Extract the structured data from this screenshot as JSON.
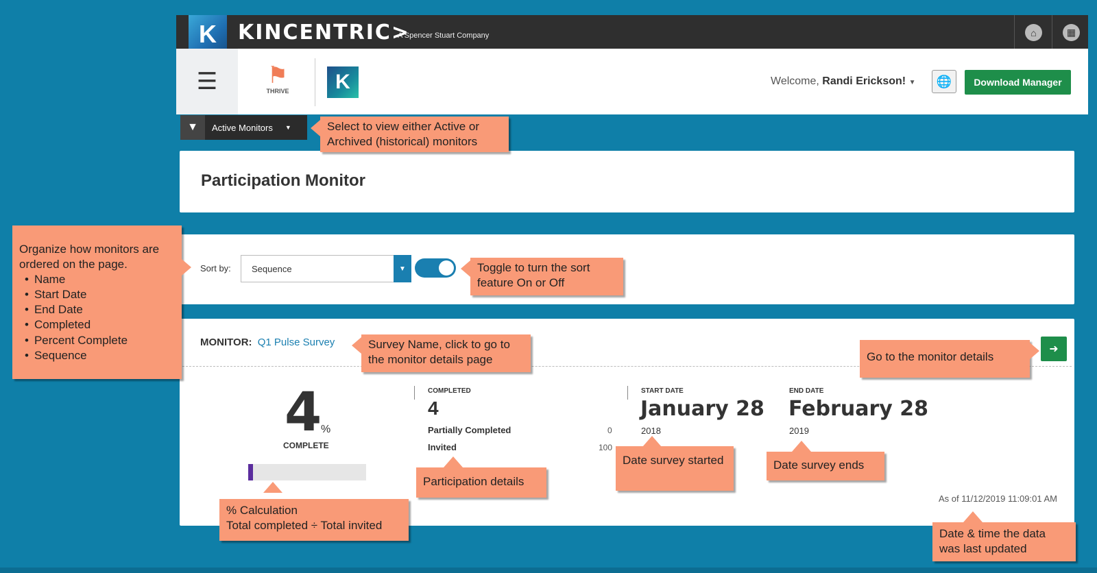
{
  "brand": {
    "logo_letter": "K",
    "name": "KINCENTRIC>",
    "subtitle": "A Spencer Stuart Company"
  },
  "header": {
    "app_name": "THRIVE",
    "small_logo_letter": "K",
    "welcome_prefix": "Welcome,",
    "user_name": "Randi Erickson!",
    "download_label": "Download Manager"
  },
  "filter": {
    "label": "Active Monitors"
  },
  "page": {
    "title": "Participation Monitor"
  },
  "sort": {
    "label": "Sort by:",
    "selected": "Sequence",
    "toggle_on": true
  },
  "monitor": {
    "label": "MONITOR:",
    "name": "Q1 Pulse Survey",
    "percent": "4",
    "percent_sign": "%",
    "percent_value": 4,
    "complete_label": "COMPLETE",
    "completed_caption": "COMPLETED",
    "completed_value": "4",
    "partially_label": "Partially Completed",
    "partially_value": "0",
    "invited_label": "Invited",
    "invited_value": "100",
    "start_caption": "START DATE",
    "start_date": "January 28",
    "start_year": "2018",
    "end_caption": "END DATE",
    "end_date": "February 28",
    "end_year": "2019",
    "as_of": "As of 11/12/2019 11:09:01 AM"
  },
  "callouts": {
    "active_monitors": "Select to view either Active or Archived (historical) monitors",
    "sort_intro": "Organize how monitors are ordered on the page.",
    "sort_options": [
      "Name",
      "Start Date",
      "End Date",
      "Completed",
      "Percent Complete",
      "Sequence"
    ],
    "toggle": "Toggle to turn the sort feature On or Off",
    "survey_name": "Survey Name, click to go to the monitor details page",
    "go_details": "Go to the monitor details",
    "pct_calc_1": "% Calculation",
    "pct_calc_2": "Total completed ÷ Total invited",
    "participation": "Participation details",
    "date_started": "Date survey started",
    "date_ends": "Date survey ends",
    "last_updated": "Date & time the data was last updated"
  },
  "colors": {
    "background": "#0f7fa8",
    "callout": "#f99a77",
    "accent_green": "#1e8e4a",
    "accent_blue": "#1a7fb0",
    "progress_fill": "#5b2d9e"
  }
}
